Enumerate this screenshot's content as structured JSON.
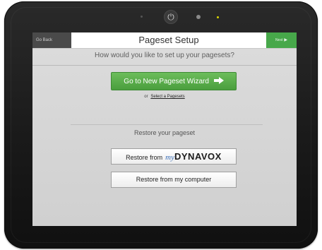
{
  "header": {
    "back_label": "Go Back",
    "title": "Pageset Setup",
    "next_label": "Next"
  },
  "main": {
    "question": "How would you like to set up your pagesets?",
    "wizard_button_label": "Go to New Pageset Wizard",
    "or_prefix": "or",
    "select_link": "Select a Pagesets",
    "restore_heading": "Restore your pageset",
    "restore_dynavox_prefix": "Restore from",
    "restore_dynavox_my": "my",
    "restore_dynavox_brand": "DYNAVOX",
    "restore_computer_label": "Restore from my computer"
  },
  "device": {
    "power_glyph": "⏻"
  },
  "colors": {
    "accent_green": "#4caf50",
    "device_body": "#1e1e1e",
    "brand_blue": "#3b6fb8"
  },
  "icons": {
    "next": "chevron-right-icon",
    "wizard": "arrow-right-icon",
    "power": "power-icon"
  }
}
